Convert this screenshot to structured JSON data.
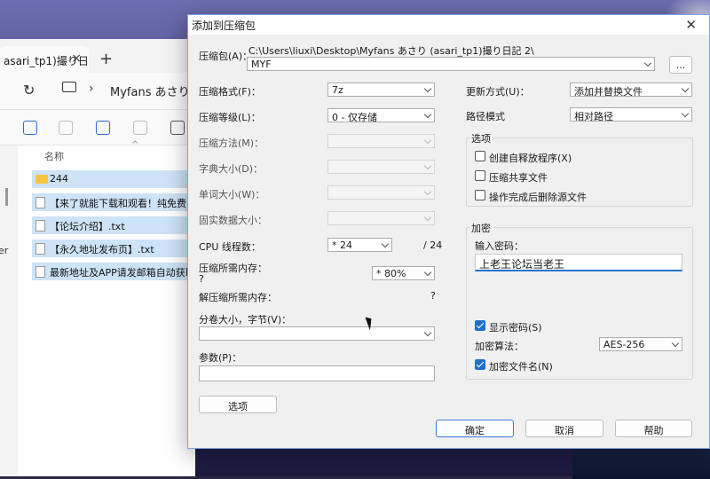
{
  "explorer": {
    "tab_label": "asari_tp1)撮り日",
    "tab_close": "×",
    "tab_new": "+",
    "refresh": "↻",
    "chevron": "›",
    "path": "Myfans あさり (",
    "column_name": "名称",
    "sort_arrow": "^",
    "left_text": "er",
    "rows": [
      {
        "label": "244"
      },
      {
        "label": "【来了就能下载和观看！纯免费！"
      },
      {
        "label": "【论坛介绍】.txt"
      },
      {
        "label": "【永久地址发布页】.txt"
      },
      {
        "label": "最新地址及APP请发邮箱自动获取"
      }
    ]
  },
  "dialog": {
    "title": "添加到压缩包",
    "close": "✕",
    "archive_label": "压缩包(A)：",
    "archive_path": "C:\\Users\\liuxi\\Desktop\\Myfans あさり (asari_tp1)撮り日記 2\\",
    "archive_name": "MYF",
    "browse_label": "...",
    "format_label": "压缩格式(F)：",
    "format_value": "7z",
    "level_label": "压缩等级(L)：",
    "level_value": "0 - 仅存储",
    "method_label": "压缩方法(M)：",
    "dict_label": "字典大小(D)：",
    "word_label": "单词大小(W)：",
    "solid_label": "固实数据大小：",
    "cpu_label": "CPU 线程数：",
    "cpu_value": "* 24",
    "cpu_total": "/ 24",
    "mem_label": "压缩所需内存：",
    "mem_q": "?",
    "mem_value": "* 80%",
    "decomp_label": "解压缩所需内存：",
    "decomp_value": "?",
    "split_label": "分卷大小，字节(V)：",
    "split_value": "",
    "params_label": "参数(P)：",
    "params_value": "",
    "options_button": "选项",
    "update_label": "更新方式(U)：",
    "update_value": "添加并替换文件",
    "path_mode_label": "路径模式",
    "path_mode_value": "相对路径",
    "options_group": {
      "title": "选项",
      "sfx": "创建自释放程序(X)",
      "shared": "压缩共享文件",
      "delete": "操作完成后删除源文件"
    },
    "encryption_group": {
      "title": "加密",
      "password_label": "输入密码：",
      "password_value": "上老王论坛当老王",
      "show_password": "显示密码(S)",
      "method_label": "加密算法：",
      "method_value": "AES-256",
      "encrypt_names": "加密文件名(N)"
    },
    "ok_button": "确定",
    "cancel_button": "取消",
    "help_button": "帮助"
  },
  "colors": {
    "accent": "#1f6fd0",
    "dialog_bg": "#f0f0f0",
    "selection": "#cde3f7"
  }
}
